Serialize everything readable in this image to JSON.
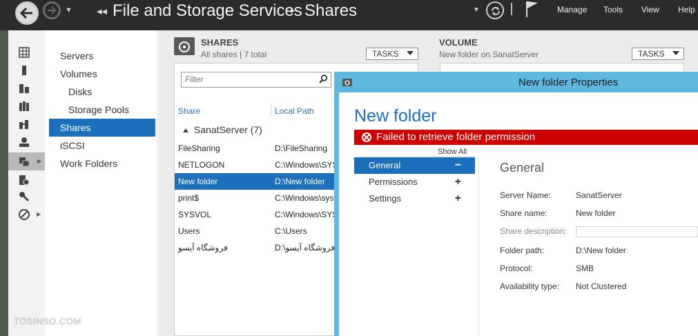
{
  "header": {
    "app_title": "File and Storage Services",
    "page_title": "Shares",
    "menu": [
      "Manage",
      "Tools",
      "View",
      "Help"
    ]
  },
  "nav": {
    "items": [
      {
        "label": "Servers"
      },
      {
        "label": "Volumes"
      },
      {
        "label": "Disks"
      },
      {
        "label": "Storage Pools"
      },
      {
        "label": "Shares"
      },
      {
        "label": "iSCSI"
      },
      {
        "label": "Work Folders"
      }
    ],
    "active": "Shares"
  },
  "watermark": "TOSINSO.COM",
  "shares_tile": {
    "title": "SHARES",
    "subtitle": "All shares | 7 total",
    "tasks_label": "TASKS",
    "filter_placeholder": "Filter",
    "columns": [
      "Share",
      "Local Path"
    ],
    "group_label": "SanatServer (7)",
    "rows": [
      {
        "share": "FileSharing",
        "path": "D:\\FileSharing"
      },
      {
        "share": "NETLOGON",
        "path": "C:\\Windows\\SYS"
      },
      {
        "share": "New folder",
        "path": "D:\\New folder"
      },
      {
        "share": "print$",
        "path": "C:\\Windows\\syst"
      },
      {
        "share": "SYSVOL",
        "path": "C:\\Windows\\SYS"
      },
      {
        "share": "Users",
        "path": "C:\\Users"
      },
      {
        "share": "فروشگاه آیسو",
        "path": "D:\\فروشگاه آیسو"
      }
    ]
  },
  "volume_tile": {
    "title": "VOLUME",
    "subtitle": "New folder on SanatServer",
    "tasks_label": "TASKS"
  },
  "dialog": {
    "title": "New folder Properties",
    "heading": "New folder",
    "error": "Failed to retrieve folder permission",
    "show_all": "Show All",
    "sections": [
      {
        "label": "General",
        "sign": "−"
      },
      {
        "label": "Permissions",
        "sign": "+"
      },
      {
        "label": "Settings",
        "sign": "+"
      }
    ],
    "general_title": "General",
    "props": {
      "server_name_label": "Server Name:",
      "server_name": "SanatServer",
      "share_name_label": "Share name:",
      "share_name": "New folder",
      "share_description_label": "Share description:",
      "folder_path_label": "Folder path:",
      "folder_path": "D:\\New folder",
      "protocol_label": "Protocol:",
      "protocol": "SMB",
      "availability_label": "Availability type:",
      "availability": "Not Clustered"
    }
  },
  "colors": {
    "selection_blue": "#1c6fba",
    "dialog_titlebar": "#5fb8e0",
    "error_red": "#cc0000",
    "header_dark": "#2b2b2b"
  }
}
